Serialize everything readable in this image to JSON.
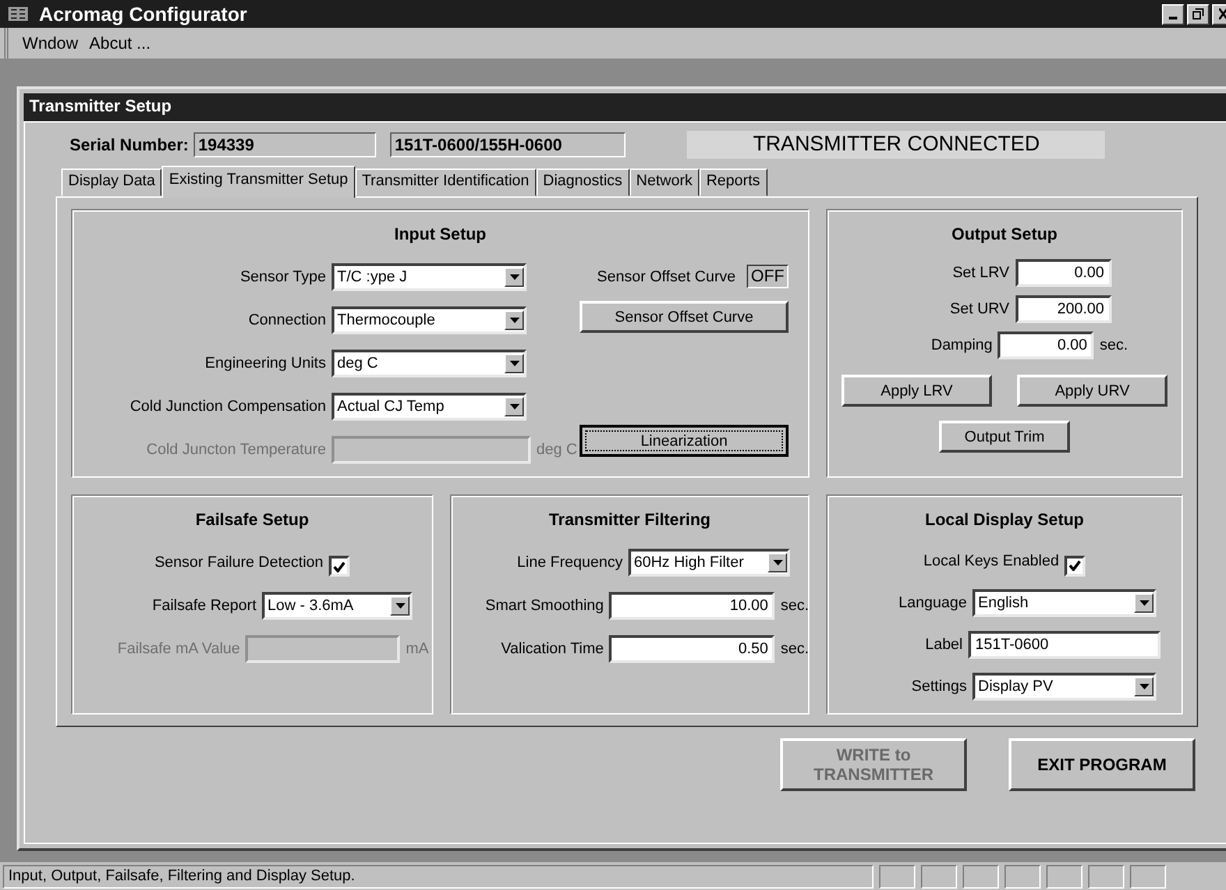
{
  "window": {
    "title": "Acromag Configurator"
  },
  "menu": [
    "Wndow",
    "Abcut ..."
  ],
  "child_window": {
    "title": "Transmitter Setup"
  },
  "header": {
    "serial_label": "Serial Number:",
    "serial": "194339",
    "model": "151T-0600/155H-0600",
    "status": "TRANSMITTER CONNECTED"
  },
  "tabs": [
    {
      "label": "Display Data",
      "selected": false
    },
    {
      "label": "Existing Transmitter Setup",
      "selected": true
    },
    {
      "label": "Transmitter Identification",
      "selected": false
    },
    {
      "label": "Diagnostics",
      "selected": false
    },
    {
      "label": "Network",
      "selected": false
    },
    {
      "label": "Reports",
      "selected": false
    }
  ],
  "input_setup": {
    "title": "Input Setup",
    "fields": [
      {
        "kind": "select",
        "label": "Sensor Type",
        "value": "T/C :ype J",
        "disabled": false
      },
      {
        "kind": "select",
        "label": "Connection",
        "value": "Thermocouple",
        "disabled": false
      },
      {
        "kind": "select",
        "label": "Engineering Units",
        "value": "deg C",
        "disabled": false
      },
      {
        "kind": "select",
        "label": "Cold Junction Compensation",
        "value": "Actual CJ Temp",
        "disabled": false
      },
      {
        "kind": "input",
        "label": "Cold Juncton Temperature",
        "unit": "deg C",
        "disabled": true
      }
    ],
    "offset_curve": {
      "label": "Sensor Offset Curve",
      "value": "OFF"
    },
    "buttons": [
      {
        "label": "Sensor Offset Curve",
        "focused": false
      },
      {
        "label": "Linearization",
        "focused": true
      }
    ]
  },
  "output_setup": {
    "title": "Output Setup",
    "fields": [
      {
        "kind": "input",
        "label": "Set LRV",
        "value": "0.00",
        "disabled": false
      },
      {
        "kind": "input",
        "label": "Set URV",
        "value": "200.00",
        "disabled": false
      },
      {
        "kind": "input",
        "label": "Damping",
        "value": "0.00",
        "unit": "sec.",
        "disabled": false
      }
    ],
    "buttons": [
      "Apply LRV",
      "Apply URV",
      "Output Trim"
    ]
  },
  "failsafe_setup": {
    "title": "Failsafe Setup",
    "fields": [
      {
        "kind": "checkbox",
        "label": "Sensor Failure Detection",
        "checked": true,
        "disabled": false
      },
      {
        "kind": "select",
        "label": "Failsafe Report",
        "value": "Low - 3.6mA",
        "disabled": false
      },
      {
        "kind": "input",
        "label": "Failsafe mA Value",
        "unit": "mA",
        "disabled": true
      }
    ]
  },
  "transmitter_filtering": {
    "title": "Transmitter Filtering",
    "fields": [
      {
        "kind": "select",
        "label": "Line Frequency",
        "value": "60Hz High Filter",
        "disabled": false
      },
      {
        "kind": "input",
        "label": "Smart Smoothing",
        "value": "10.00",
        "unit": "sec.",
        "disabled": false
      },
      {
        "kind": "input",
        "label": "Valication Time",
        "value": "0.50",
        "unit": "sec.",
        "disabled": false
      }
    ]
  },
  "local_display_setup": {
    "title": "Local Display Setup",
    "fields": [
      {
        "kind": "checkbox",
        "label": "Local Keys Enabled",
        "checked": true,
        "disabled": false
      },
      {
        "kind": "select",
        "label": "Language",
        "value": "English",
        "disabled": false
      },
      {
        "kind": "text",
        "label": "Label",
        "value": "151T-0600",
        "disabled": false
      },
      {
        "kind": "select",
        "label": "Settings",
        "value": "Display PV",
        "disabled": false
      }
    ]
  },
  "actions": [
    {
      "label": "WRITE to TRANSMITTER",
      "disabled": true
    },
    {
      "label": "EXIT PROGRAM",
      "disabled": false
    }
  ],
  "status_bar": {
    "text": "Input, Output, Failsafe, Filtering and Display Setup."
  }
}
